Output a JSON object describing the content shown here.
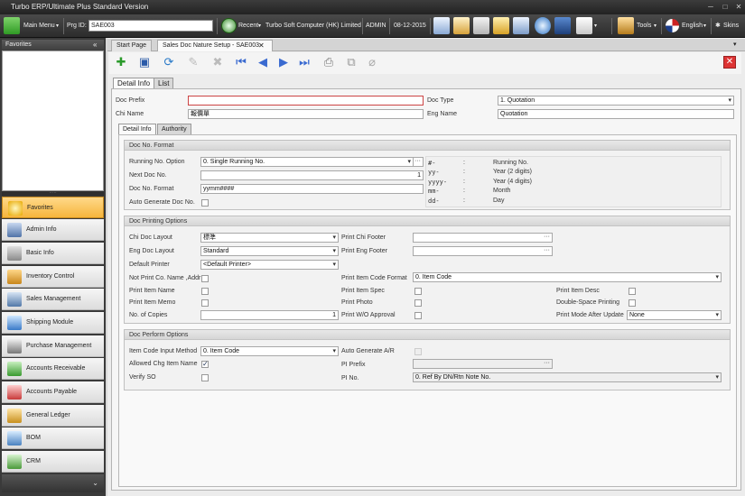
{
  "titlebar": {
    "title": "Turbo ERP/Ultimate Plus Standard Version"
  },
  "toolbar": {
    "main_menu": "Main Menu",
    "prg_id_label": "Prg ID:",
    "prg_id_value": "SAE003",
    "recent": "Recent",
    "company": "Turbo Soft Computer (HK) Limited",
    "user": "ADMIN",
    "date": "08-12-2015",
    "tools": "Tools",
    "language": "English",
    "skins": "Skins"
  },
  "sidebar": {
    "favorites_title": "Favorites",
    "items": [
      {
        "label": "Favorites",
        "icon": "star-icon"
      },
      {
        "label": "Admin Info",
        "icon": "admin-icon"
      },
      {
        "label": "Basic Info",
        "icon": "basic-info-icon"
      },
      {
        "label": "Inventory Control",
        "icon": "inventory-icon"
      },
      {
        "label": "Sales Management",
        "icon": "sales-icon"
      },
      {
        "label": "Shipping Module",
        "icon": "shipping-icon"
      },
      {
        "label": "Purchase Management",
        "icon": "purchase-icon"
      },
      {
        "label": "Accounts Receivable",
        "icon": "receivable-icon"
      },
      {
        "label": "Accounts Payable",
        "icon": "payable-icon"
      },
      {
        "label": "General Ledger",
        "icon": "ledger-icon"
      },
      {
        "label": "BOM",
        "icon": "bom-icon"
      },
      {
        "label": "CRM",
        "icon": "crm-icon"
      }
    ]
  },
  "tabs": {
    "start_page": "Start Page",
    "doc_tab": "Sales Doc Nature Setup - SAE003"
  },
  "main_tabs": {
    "detail": "Detail Info",
    "list": "List"
  },
  "header": {
    "doc_prefix_label": "Doc Prefix",
    "doc_prefix_value": "",
    "doc_type_label": "Doc Type",
    "doc_type_value": "1. Quotation",
    "chi_name_label": "Chi Name",
    "chi_name_value": "報價單",
    "eng_name_label": "Eng Name",
    "eng_name_value": "Quotation"
  },
  "sub_tabs": {
    "detail": "Detail Info",
    "authority": "Authority"
  },
  "doc_no_format": {
    "title": "Doc No. Format",
    "running_no_label": "Running No. Option",
    "running_no_value": "0. Single Running No.",
    "next_doc_label": "Next Doc No.",
    "next_doc_value": "1",
    "format_label": "Doc No. Format",
    "format_value": "yymm####",
    "auto_gen_label": "Auto Generate Doc No.",
    "legend": [
      {
        "key": "#-",
        "sep": ":",
        "desc": "Running No."
      },
      {
        "key": "yy-",
        "sep": ":",
        "desc": "Year (2 digits)"
      },
      {
        "key": "yyyy-",
        "sep": ":",
        "desc": "Year (4 digits)"
      },
      {
        "key": "mm-",
        "sep": ":",
        "desc": "Month"
      },
      {
        "key": "dd-",
        "sep": ":",
        "desc": "Day"
      }
    ]
  },
  "printing": {
    "title": "Doc Printing Options",
    "chi_layout_label": "Chi Doc Layout",
    "chi_layout_value": "標準",
    "eng_layout_label": "Eng Doc Layout",
    "eng_layout_value": "Standard",
    "default_printer_label": "Default Printer",
    "default_printer_value": "<Default Printer>",
    "not_print_label": "Not Print Co. Name ,Addr",
    "item_name_label": "Print Item Name",
    "item_memo_label": "Print Item Memo",
    "copies_label": "No. of Copies",
    "copies_value": "1",
    "chi_footer_label": "Print Chi Footer",
    "eng_footer_label": "Print Eng Footer",
    "item_code_format_label": "Print Item Code Format",
    "item_code_format_value": "0. Item Code",
    "item_spec_label": "Print Item Spec",
    "photo_label": "Print Photo",
    "wo_approval_label": "Print W/O Approval",
    "item_desc_label": "Print Item Desc",
    "double_space_label": "Double-Space Printing",
    "mode_after_label": "Print Mode After Update",
    "mode_after_value": "None"
  },
  "perform": {
    "title": "Doc Perform Options",
    "input_method_label": "Item Code Input Method",
    "input_method_value": "0. Item Code",
    "allow_chg_label": "Allowed Chg Item Name",
    "verify_so_label": "Verify SO",
    "auto_ar_label": "Auto Generate A/R",
    "pi_prefix_label": "PI Prefix",
    "pi_no_label": "PI No.",
    "pi_no_value": "0. Ref By DN/Rtn Note No."
  }
}
